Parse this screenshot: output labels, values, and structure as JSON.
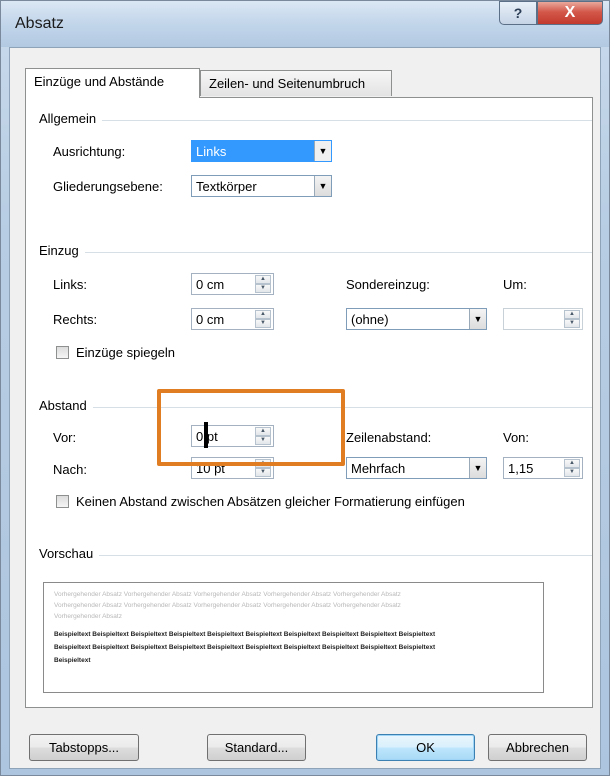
{
  "window": {
    "title": "Absatz",
    "help_label": "?",
    "close_label": "X"
  },
  "tabs": [
    {
      "label": "Einzüge und Abstände",
      "active": true
    },
    {
      "label": "Zeilen- und Seitenumbruch",
      "active": false
    }
  ],
  "general": {
    "title": "Allgemein",
    "alignment_label": "Ausrichtung:",
    "alignment_value": "Links",
    "outline_label": "Gliederungsebene:",
    "outline_value": "Textkörper"
  },
  "indent": {
    "title": "Einzug",
    "left_label": "Links:",
    "left_value": "0 cm",
    "right_label": "Rechts:",
    "right_value": "0 cm",
    "special_label": "Sondereinzug:",
    "special_value": "(ohne)",
    "by_label": "Um:",
    "by_value": "",
    "mirror_label": "Einzüge spiegeln",
    "mirror_checked": false
  },
  "spacing": {
    "title": "Abstand",
    "before_label": "Vor:",
    "before_value": "0 pt",
    "after_label": "Nach:",
    "after_value": "10 pt",
    "line_spacing_label": "Zeilenabstand:",
    "line_spacing_value": "Mehrfach",
    "at_label": "Von:",
    "at_value": "1,15",
    "no_space_label": "Keinen Abstand zwischen Absätzen gleicher Formatierung einfügen",
    "no_space_checked": false
  },
  "preview": {
    "title": "Vorschau",
    "prev_lines": [
      "Vorhergehender Absatz Vorhergehender Absatz Vorhergehender Absatz Vorhergehender Absatz Vorhergehender Absatz",
      "Vorhergehender Absatz Vorhergehender Absatz Vorhergehender Absatz Vorhergehender Absatz Vorhergehender Absatz",
      "Vorhergehender Absatz"
    ],
    "sample_lines": [
      "Beispieltext Beispieltext Beispieltext Beispieltext Beispieltext Beispieltext Beispieltext Beispieltext Beispieltext Beispieltext",
      "Beispieltext Beispieltext Beispieltext Beispieltext Beispieltext Beispieltext Beispieltext Beispieltext Beispieltext Beispieltext",
      "Beispieltext"
    ]
  },
  "buttons": {
    "tabs": "Tabstopps...",
    "default": "Standard...",
    "ok": "OK",
    "cancel": "Abbrechen"
  },
  "colors": {
    "highlight": "#e07d22",
    "selection": "#3399ff"
  }
}
